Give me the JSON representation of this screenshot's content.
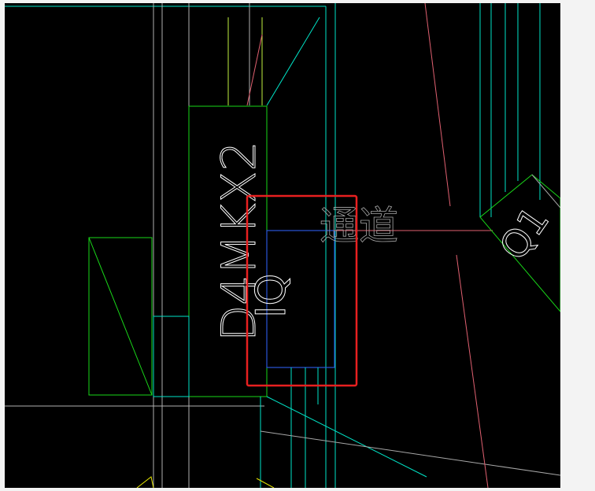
{
  "drawing": {
    "labels": {
      "cabinet_tag": "D4MKX2",
      "unit_tag": "IQ",
      "unit_tag_right": "Q1",
      "passage": "通道"
    },
    "colors": {
      "background": "#000000",
      "frame": "#ffffff",
      "cyan": "#00e5c8",
      "green": "#19d819",
      "red_dim": "#e06070",
      "blue": "#2a55d8",
      "highlight": "#e82020",
      "yellow": "#e8e800",
      "gray": "#a8a8a8"
    }
  }
}
